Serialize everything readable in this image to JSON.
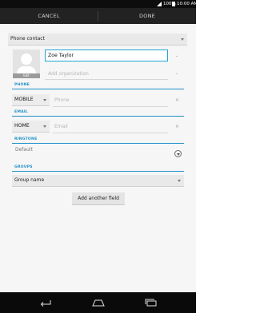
{
  "status_bar": {
    "battery": "100%",
    "time": "10:00 AM",
    "signal_icon": "signal-icon",
    "battery_icon": "battery-icon"
  },
  "action_bar": {
    "cancel_label": "CANCEL",
    "done_label": "DONE"
  },
  "account": {
    "selected": "Phone contact"
  },
  "name": {
    "value": "Zoe Taylor",
    "avatar_strip_label": "Edit"
  },
  "organization": {
    "placeholder": "Add organization"
  },
  "phone": {
    "section_label": "PHONE",
    "type": "MOBILE",
    "placeholder": "Phone"
  },
  "email": {
    "section_label": "EMAIL",
    "type": "HOME",
    "placeholder": "Email"
  },
  "ringtone": {
    "section_label": "RINGTONE",
    "value": "Default"
  },
  "groups": {
    "section_label": "GROUPS",
    "selected": "Group name"
  },
  "add_field": {
    "label": "Add another field"
  },
  "colors": {
    "accent": "#1fa4d6",
    "action_bar": "#222222",
    "nav_bar": "#0a0a0a"
  },
  "nav_icons": [
    "back-icon",
    "home-icon",
    "recent-apps-icon"
  ]
}
